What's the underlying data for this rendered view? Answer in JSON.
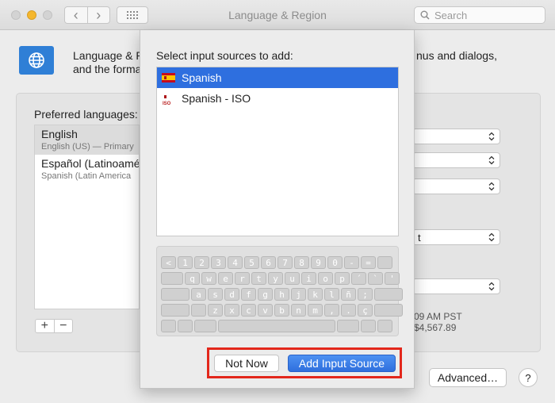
{
  "window": {
    "title": "Language & Region",
    "search_placeholder": "Search",
    "back_glyph": "‹",
    "forward_glyph": "›"
  },
  "pane": {
    "intro_line1": "Language & R",
    "intro_line2": "and the forma",
    "intro_right": "nus and dialogs,",
    "preferred_label": "Preferred languages:",
    "languages": [
      {
        "name": "English",
        "detail": "English (US) — Primary"
      },
      {
        "name": "Español (Latinoamé",
        "detail": "Spanish (Latin America"
      }
    ],
    "add_glyph": "+",
    "remove_glyph": "−",
    "popup_4_value": "t",
    "time_preview": "09 AM PST",
    "number_preview": "$4,567.89",
    "advanced_label": "Advanced…",
    "help_label": "?"
  },
  "sheet": {
    "heading": "Select input sources to add:",
    "sources": [
      {
        "label": "Spanish",
        "selected": true
      },
      {
        "label": "Spanish - ISO",
        "selected": false,
        "tag": "ISO"
      }
    ],
    "keyboard_rows": [
      [
        "<",
        "1",
        "2",
        "3",
        "4",
        "5",
        "6",
        "7",
        "8",
        "9",
        "0",
        "-",
        "="
      ],
      [
        "q",
        "w",
        "e",
        "r",
        "t",
        "y",
        "u",
        "i",
        "o",
        "p",
        "´",
        "`",
        "'"
      ],
      [
        "a",
        "s",
        "d",
        "f",
        "g",
        "h",
        "j",
        "k",
        "l",
        "ñ",
        ";"
      ],
      [
        "z",
        "x",
        "c",
        "v",
        "b",
        "n",
        "m",
        ",",
        ".",
        "ç"
      ]
    ],
    "not_now_label": "Not Now",
    "add_label": "Add Input Source"
  },
  "colors": {
    "selection": "#2e6fdf",
    "highlight_box": "#e3271b",
    "traffic_yellow": "#f5b72d"
  }
}
